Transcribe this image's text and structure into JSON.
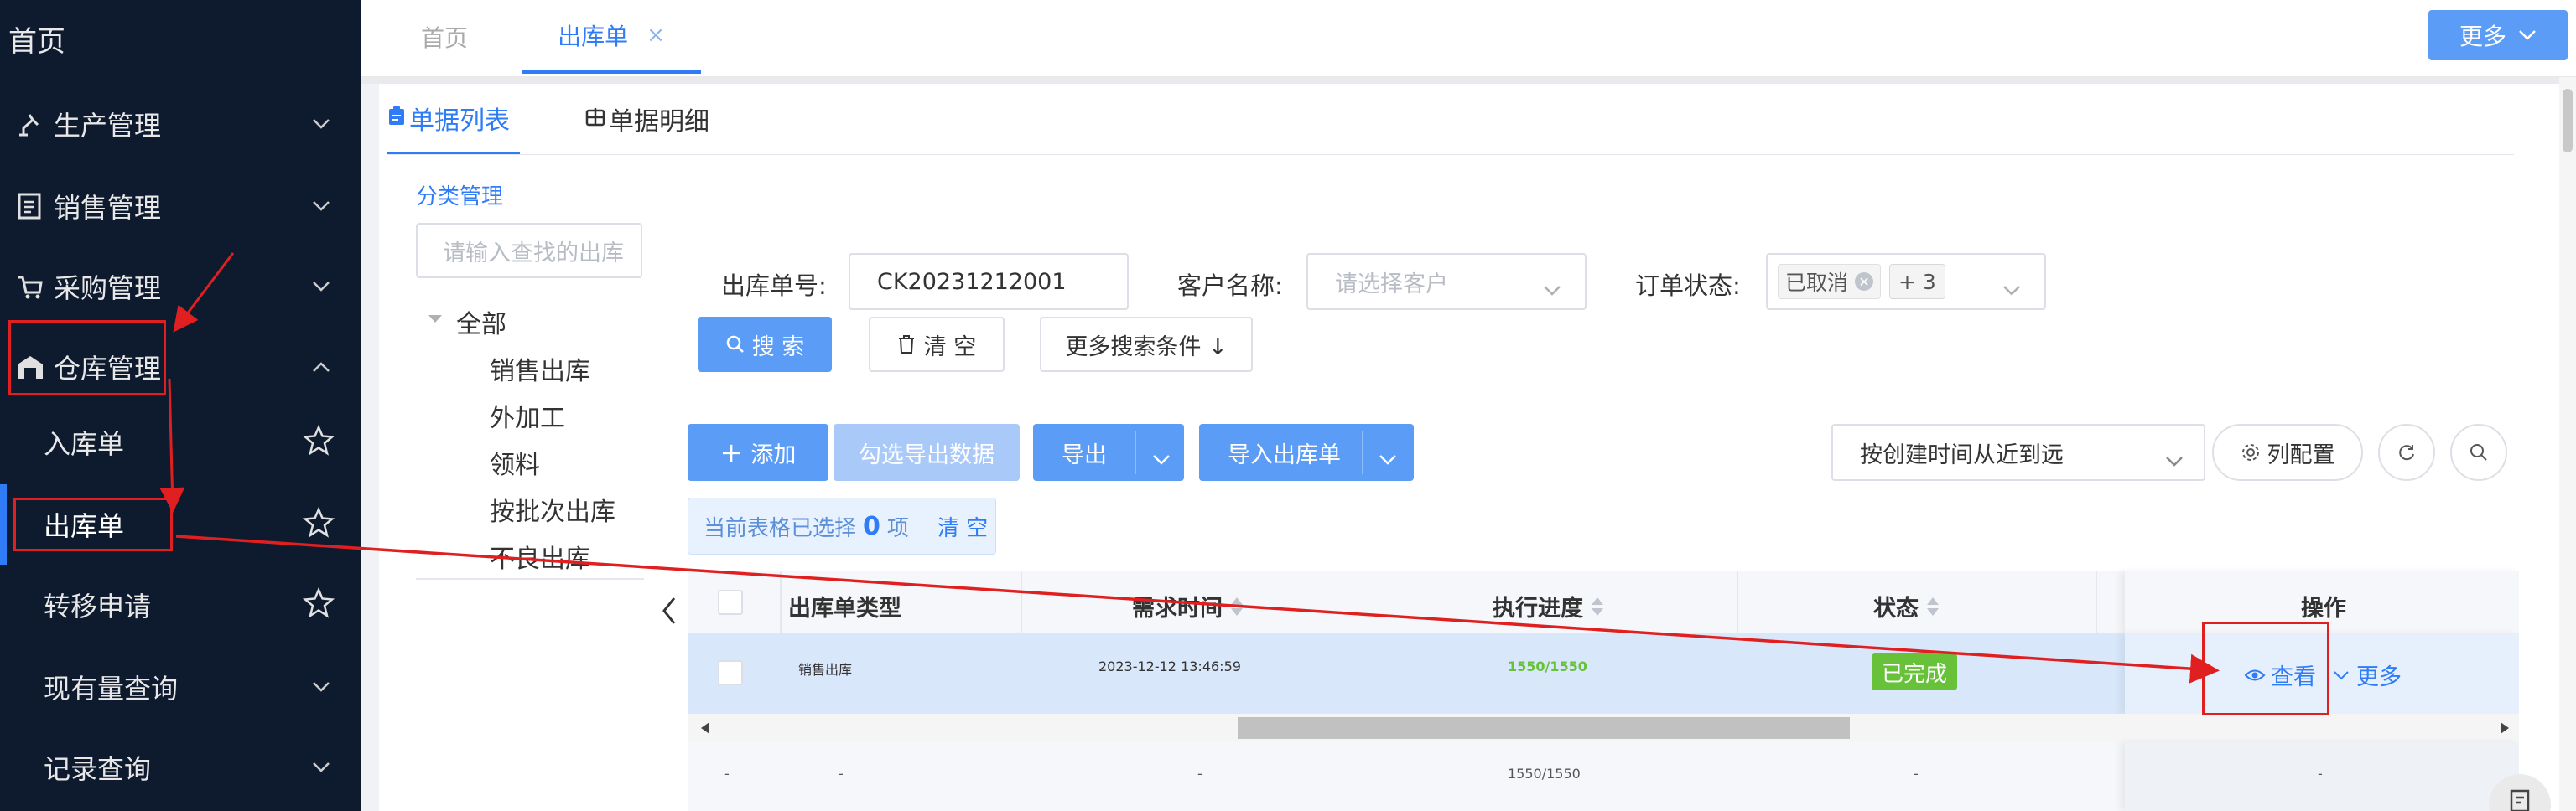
{
  "sidebar": {
    "home": "首页",
    "items": [
      {
        "label": "生产管理"
      },
      {
        "label": "销售管理"
      },
      {
        "label": "采购管理"
      },
      {
        "label": "仓库管理"
      }
    ],
    "sub_items": [
      {
        "label": "入库单"
      },
      {
        "label": "出库单"
      },
      {
        "label": "转移申请"
      }
    ],
    "items2": [
      {
        "label": "现有量查询"
      },
      {
        "label": "记录查询"
      }
    ]
  },
  "tabs": [
    {
      "label": "首页"
    },
    {
      "label": "出库单",
      "close": "×"
    }
  ],
  "header": {
    "more_label": "更多"
  },
  "sub_tabs": [
    {
      "label": "单据列表"
    },
    {
      "label": "单据明细"
    }
  ],
  "category": {
    "title": "分类管理",
    "search_placeholder": "请输入查找的出库",
    "tree": [
      "全部",
      "销售出库",
      "外加工",
      "领料",
      "按批次出库",
      "不良出库"
    ]
  },
  "filters": {
    "order_no_label": "出库单号:",
    "order_no_value": "CK20231212001",
    "customer_label": "客户名称:",
    "customer_placeholder": "请选择客户",
    "status_label": "订单状态:",
    "status_tag": "已取消",
    "status_more": "+ 3"
  },
  "buttons": {
    "search": "搜 索",
    "clear": "清 空",
    "more_search": "更多搜索条件 ↓",
    "add": "添加",
    "export_checked": "勾选导出数据",
    "export": "导出",
    "import": "导入出库单",
    "sort": "按创建时间从近到远",
    "columns": "列配置"
  },
  "selection": {
    "prefix": "当前表格已选择",
    "count": "0",
    "suffix": "项",
    "clear": "清 空"
  },
  "table": {
    "headers": [
      "出库单类型",
      "需求时间",
      "执行进度",
      "状态",
      "操作"
    ],
    "rows": [
      {
        "type": "销售出库",
        "time": "2023-12-12 13:46:59",
        "progress": "1550/1550",
        "status": "已完成",
        "view": "查看",
        "more": "更多"
      },
      {
        "sel": "-",
        "type": "-",
        "time": "-",
        "progress": "1550/1550",
        "status": "-",
        "op": "-"
      }
    ]
  },
  "colors": {
    "sidebar_bg": "#0e1a2e",
    "accent": "#2f7cf6",
    "success": "#67c23a",
    "annotation": "#e02020"
  }
}
